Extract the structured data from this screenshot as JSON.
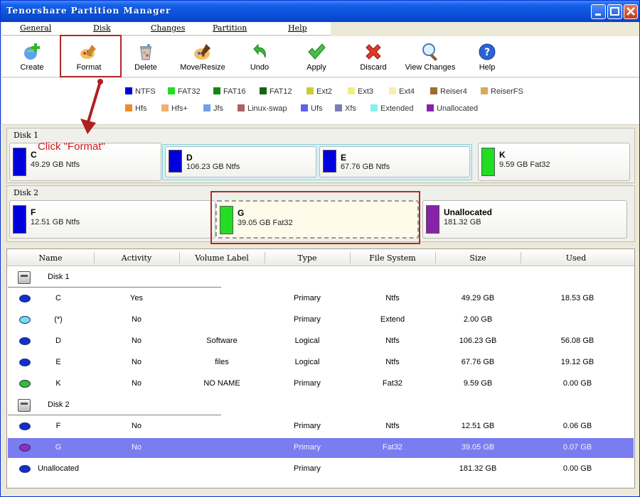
{
  "window": {
    "title": "Tenorshare Partition Manager"
  },
  "menu": [
    "General",
    "Disk",
    "Changes",
    "Partition",
    "Help"
  ],
  "toolbar": [
    {
      "label": "Create",
      "icon": "create-icon"
    },
    {
      "label": "Format",
      "icon": "format-icon"
    },
    {
      "label": "Delete",
      "icon": "delete-icon"
    },
    {
      "label": "Move/Resize",
      "icon": "move-resize-icon"
    },
    {
      "label": "Undo",
      "icon": "undo-icon"
    },
    {
      "label": "Apply",
      "icon": "apply-icon"
    },
    {
      "label": "Discard",
      "icon": "discard-icon"
    },
    {
      "label": "View Changes",
      "icon": "view-changes-icon"
    },
    {
      "label": "Help",
      "icon": "help-icon"
    }
  ],
  "legend": [
    {
      "label": "NTFS",
      "color": "#0000dd"
    },
    {
      "label": "FAT32",
      "color": "#22dd22"
    },
    {
      "label": "FAT16",
      "color": "#118811"
    },
    {
      "label": "FAT12",
      "color": "#116611"
    },
    {
      "label": "Ext2",
      "color": "#cccc33"
    },
    {
      "label": "Ext3",
      "color": "#eeee88"
    },
    {
      "label": "Ext4",
      "color": "#f5f1b0"
    },
    {
      "label": "Reiser4",
      "color": "#9b6f2a"
    },
    {
      "label": "ReiserFS",
      "color": "#d9a860"
    },
    {
      "label": "Hfs",
      "color": "#f08a2a"
    },
    {
      "label": "Hfs+",
      "color": "#f0b070"
    },
    {
      "label": "Jfs",
      "color": "#6fa0e8"
    },
    {
      "label": "Linux-swap",
      "color": "#b06060"
    },
    {
      "label": "Ufs",
      "color": "#6060f0"
    },
    {
      "label": "Xfs",
      "color": "#7b7bb8"
    },
    {
      "label": "Extended",
      "color": "#88f0f0"
    },
    {
      "label": "Unallocated",
      "color": "#8822aa"
    }
  ],
  "disk1": {
    "label": "Disk 1",
    "partitions": [
      {
        "name": "C",
        "info": "49.29 GB Ntfs",
        "color": "#0000dd"
      },
      {
        "name": "D",
        "info": "106.23 GB Ntfs",
        "color": "#0000dd"
      },
      {
        "name": "E",
        "info": "67.76 GB Ntfs",
        "color": "#0000dd"
      },
      {
        "name": "K",
        "info": "9.59 GB Fat32",
        "color": "#22dd22"
      }
    ]
  },
  "disk2": {
    "label": "Disk 2",
    "partitions": [
      {
        "name": "F",
        "info": "12.51 GB Ntfs",
        "color": "#0000dd"
      },
      {
        "name": "G",
        "info": "39.05 GB Fat32",
        "color": "#22dd22"
      },
      {
        "name": "Unallocated",
        "info": "181.32 GB",
        "color": "#8822aa"
      }
    ]
  },
  "callout": "Click \"Format\"",
  "table": {
    "columns": [
      "Name",
      "Activity",
      "Volume Label",
      "Type",
      "File System",
      "Size",
      "Used"
    ],
    "rows": [
      {
        "kind": "disk",
        "name": "Disk 1"
      },
      {
        "kind": "part",
        "name": "C",
        "activity": "Yes",
        "label": "",
        "type": "Primary",
        "fs": "Ntfs",
        "size": "49.29 GB",
        "used": "18.53 GB",
        "color": "#1030d0"
      },
      {
        "kind": "part",
        "name": "(*)",
        "activity": "No",
        "label": "",
        "type": "Primary",
        "fs": "Extend",
        "size": "2.00 GB",
        "used": "",
        "color": "#70e0f0"
      },
      {
        "kind": "part",
        "name": "D",
        "activity": "No",
        "label": "Software",
        "type": "Logical",
        "fs": "Ntfs",
        "size": "106.23 GB",
        "used": "56.08 GB",
        "color": "#1030d0"
      },
      {
        "kind": "part",
        "name": "E",
        "activity": "No",
        "label": "files",
        "type": "Logical",
        "fs": "Ntfs",
        "size": "67.76 GB",
        "used": "19.12 GB",
        "color": "#1030d0"
      },
      {
        "kind": "part",
        "name": "K",
        "activity": "No",
        "label": "NO NAME",
        "type": "Primary",
        "fs": "Fat32",
        "size": "9.59 GB",
        "used": "0.00 GB",
        "color": "#30c030"
      },
      {
        "kind": "disk",
        "name": "Disk 2"
      },
      {
        "kind": "part",
        "name": "F",
        "activity": "No",
        "label": "",
        "type": "Primary",
        "fs": "Ntfs",
        "size": "12.51 GB",
        "used": "0.06 GB",
        "color": "#1030d0"
      },
      {
        "kind": "part",
        "name": "G",
        "activity": "No",
        "label": "",
        "type": "Primary",
        "fs": "Fat32",
        "size": "39.05 GB",
        "used": "0.07 GB",
        "color": "#9030c0",
        "selected": true
      },
      {
        "kind": "part",
        "name": "Unallocated",
        "activity": "",
        "label": "",
        "type": "Primary",
        "fs": "",
        "size": "181.32 GB",
        "used": "0.00 GB",
        "color": "#1030d0"
      }
    ]
  }
}
